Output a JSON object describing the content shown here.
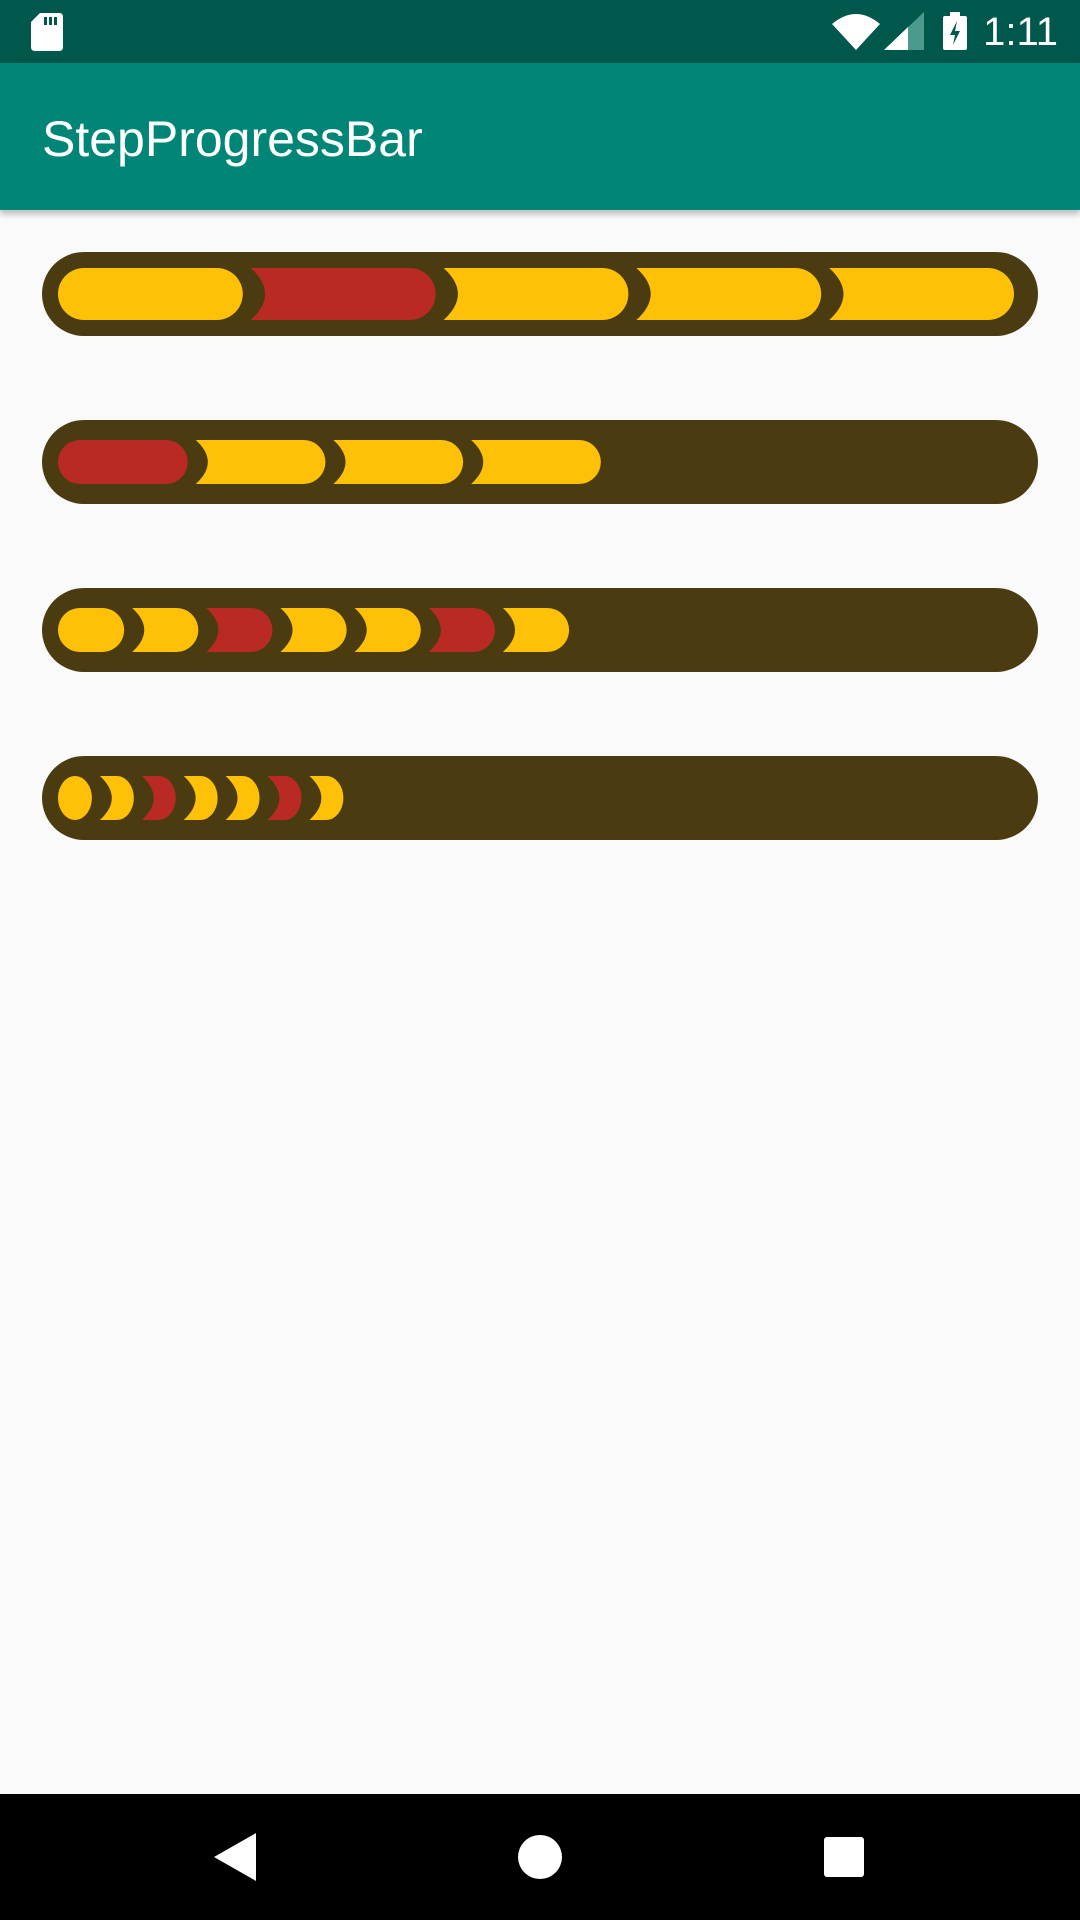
{
  "status_bar": {
    "time": "1:11",
    "icons": [
      "sd-card-icon",
      "wifi-icon",
      "cell-signal-icon",
      "battery-charging-icon"
    ]
  },
  "app_bar": {
    "title": "StepProgressBar"
  },
  "colors": {
    "status_bar_bg": "#00574b",
    "app_bar_bg": "#008577",
    "track": "#4a3c10",
    "step_yellow": "#ffc107",
    "step_red": "#ba2a25",
    "background": "#fafafa",
    "nav_bg": "#000000"
  },
  "progress_bars": [
    {
      "name": "progress-bar-1",
      "max_steps": 5,
      "steps": [
        "yellow",
        "red",
        "yellow",
        "yellow",
        "yellow"
      ]
    },
    {
      "name": "progress-bar-2",
      "max_steps": 7,
      "steps": [
        "red",
        "yellow",
        "yellow",
        "yellow"
      ]
    },
    {
      "name": "progress-bar-3",
      "max_steps": 13,
      "steps": [
        "yellow",
        "yellow",
        "red",
        "yellow",
        "yellow",
        "red",
        "yellow"
      ]
    },
    {
      "name": "progress-bar-4",
      "max_steps": 23,
      "steps": [
        "yellow",
        "yellow",
        "red",
        "yellow",
        "yellow",
        "red",
        "yellow"
      ]
    }
  ],
  "nav_bar": {
    "buttons": [
      "back-icon",
      "home-icon",
      "recents-icon"
    ]
  }
}
